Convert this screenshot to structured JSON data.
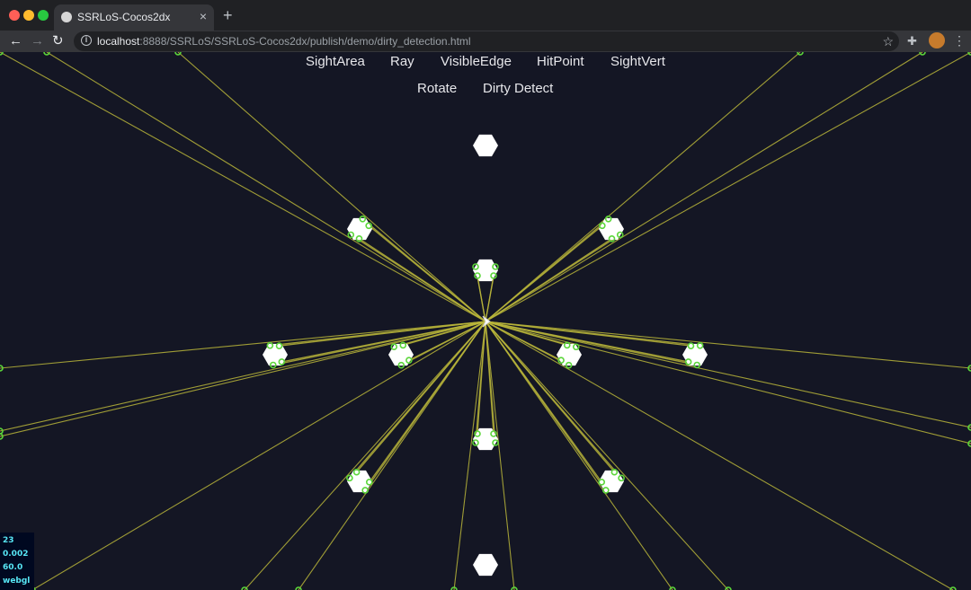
{
  "window": {
    "tab_title": "SSRLoS-Cocos2dx",
    "tab_close": "×",
    "new_tab": "+"
  },
  "navigation": {
    "back": "←",
    "forward": "→",
    "reload": "↻"
  },
  "address_bar": {
    "host": "localhost",
    "path": ":8888/SSRLoS/SSRLoS-Cocos2dx/publish/demo/dirty_detection.html",
    "star": "☆"
  },
  "demo_menu": {
    "row1": [
      "SightArea",
      "Ray",
      "VisibleEdge",
      "HitPoint",
      "SightVert"
    ],
    "row2": [
      "Rotate",
      "Dirty Detect"
    ]
  },
  "stats": {
    "draw_calls": "23",
    "frame_time": "0.002",
    "fps": "60.0",
    "renderer": "webgl"
  },
  "colors": {
    "background": "#141624",
    "ray": "#b8b53a",
    "hit_point": "#5bd63a",
    "obstacle": "#ffffff"
  },
  "icons": [
    "info-icon",
    "extension-icon",
    "menu-icon"
  ]
}
